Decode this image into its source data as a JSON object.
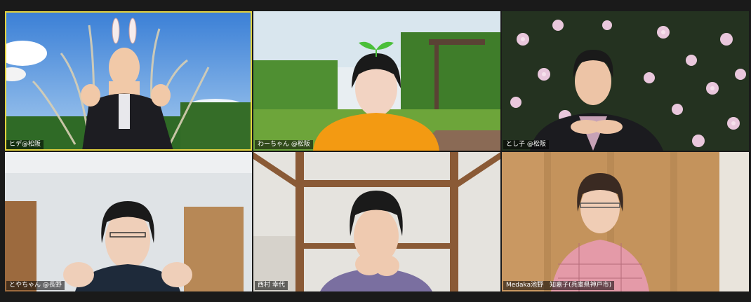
{
  "participants": [
    {
      "name": "ヒデ@松阪",
      "active": true,
      "background": "pampas-grass-sky"
    },
    {
      "name": "わーちゃん @松阪",
      "active": false,
      "background": "garden-pergola"
    },
    {
      "name": "とし子 @松阪",
      "active": false,
      "background": "pink-flowers"
    },
    {
      "name": "とやちゃん @長野",
      "active": false,
      "background": "white-room"
    },
    {
      "name": "西村 幸代",
      "active": false,
      "background": "wooden-beams-room"
    },
    {
      "name": "Medaka池野　知嘉子(兵庫県神戸市)",
      "active": false,
      "background": "wooden-wardrobe"
    }
  ],
  "colors": {
    "app_background": "#1a1a1a",
    "active_speaker_border": "#e2d23f"
  }
}
